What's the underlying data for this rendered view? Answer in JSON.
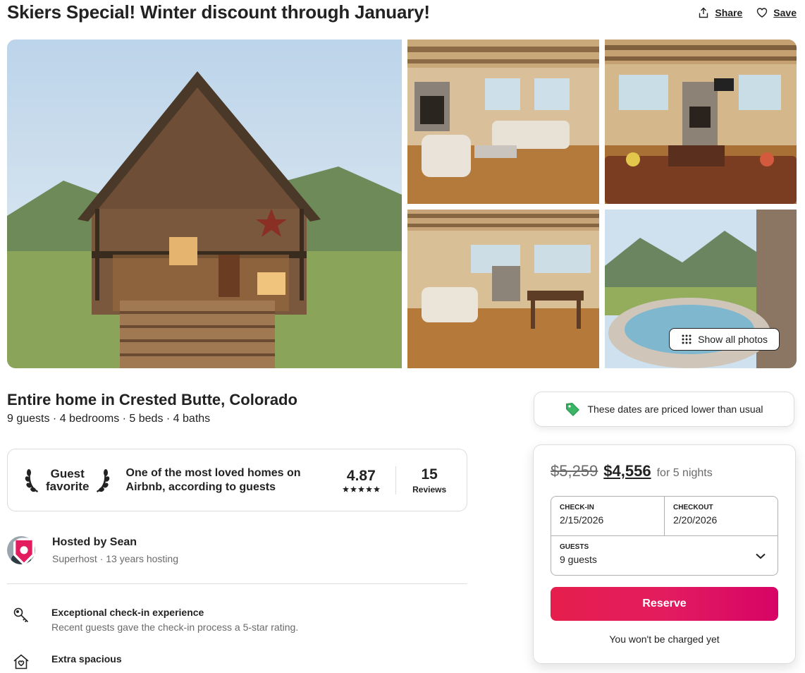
{
  "header": {
    "title": "Skiers Special! Winter discount through January!",
    "share_label": "Share",
    "save_label": "Save"
  },
  "gallery": {
    "show_all_label": "Show all photos",
    "photos": [
      "Cabin exterior with porch and star",
      "Living room with fireplace",
      "Living room with leather sofa",
      "Open living and dining area",
      "Hot tub with mountain view"
    ]
  },
  "listing": {
    "type": "Entire home in Crested Butte, Colorado",
    "meta": "9 guests · 4 bedrooms · 5 beds · 4 baths"
  },
  "guest_favorite": {
    "badge_line1": "Guest",
    "badge_line2": "favorite",
    "description": "One of the most loved homes on Airbnb, according to guests",
    "rating": "4.87",
    "star_count": 5,
    "reviews_count": "15",
    "reviews_label": "Reviews"
  },
  "host": {
    "name": "Hosted by Sean",
    "subtitle": "Superhost · 13 years hosting"
  },
  "highlights": [
    {
      "title": "Exceptional check-in experience",
      "desc": "Recent guests gave the check-in process a 5-star rating.",
      "icon": "key-icon"
    },
    {
      "title": "Extra spacious",
      "desc": "",
      "icon": "home-heart-icon"
    }
  ],
  "notice": {
    "text": "These dates are priced lower than usual"
  },
  "booking": {
    "old_price": "$5,259",
    "new_price": "$4,556",
    "per_nights": "for 5 nights",
    "checkin_label": "CHECK-IN",
    "checkin_value": "2/15/2026",
    "checkout_label": "CHECKOUT",
    "checkout_value": "2/20/2026",
    "guests_label": "GUESTS",
    "guests_value": "9 guests",
    "reserve_label": "Reserve",
    "no_charge": "You won't be charged yet"
  },
  "colors": {
    "brand": "#e31c5f",
    "text": "#222222",
    "muted": "#6a6a6a",
    "border": "#dddddd",
    "tag_green": "#2e9e55"
  }
}
